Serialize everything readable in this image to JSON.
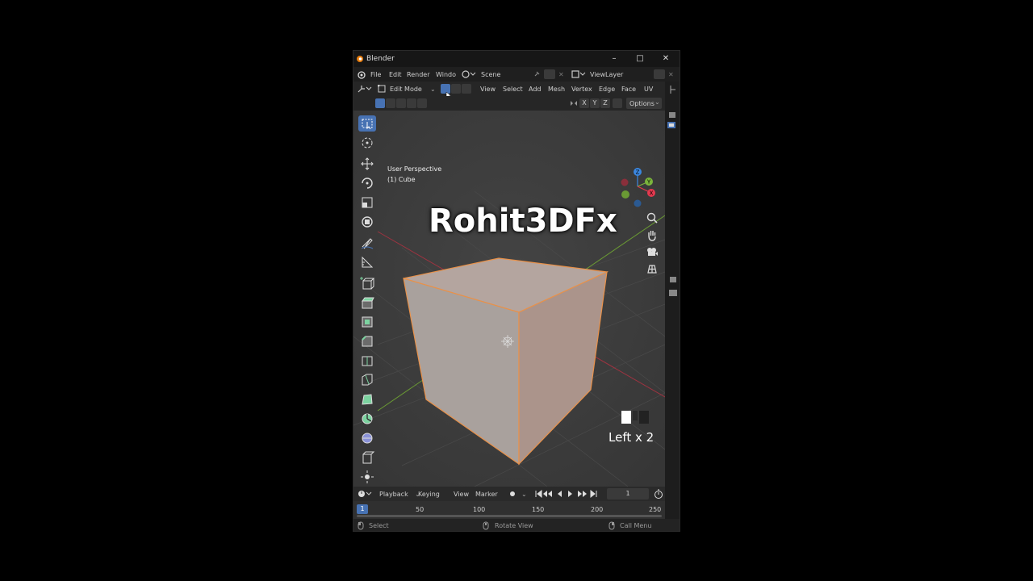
{
  "window": {
    "title": "Blender"
  },
  "menubar": {
    "file": "File",
    "edit": "Edit",
    "render": "Render",
    "window": "Windo",
    "scene": "Scene",
    "view_layer": "ViewLayer"
  },
  "header": {
    "mode": "Edit Mode",
    "view": "View",
    "select": "Select",
    "add": "Add",
    "mesh": "Mesh",
    "vertex": "Vertex",
    "edge": "Edge",
    "face": "Face",
    "uv": "UV"
  },
  "subheader": {
    "axis_x": "X",
    "axis_y": "Y",
    "axis_z": "Z",
    "options": "Options"
  },
  "viewport": {
    "view_name": "User Perspective",
    "object_name": "(1) Cube",
    "watermark": "Rohit3DFx",
    "key_indicator": "Left x 2",
    "gizmo": {
      "y": "Y",
      "x": "X",
      "z": "Z"
    }
  },
  "timeline": {
    "playback": "Playback",
    "keying": "Keying",
    "view": "View",
    "marker": "Marker",
    "current_frame": "1"
  },
  "ruler": {
    "ticks": [
      "1",
      "50",
      "100",
      "150",
      "200",
      "250"
    ]
  },
  "statusbar": {
    "select": "Select",
    "rotate": "Rotate View",
    "call_menu": "Call Menu"
  },
  "colors": {
    "active_blue": "#4772b3",
    "cube_face": "#b8a9a3",
    "cube_edge": "#e8914a",
    "x_axis": "#e5394f",
    "y_axis": "#7ab33c",
    "z_axis": "#3b87e0"
  }
}
